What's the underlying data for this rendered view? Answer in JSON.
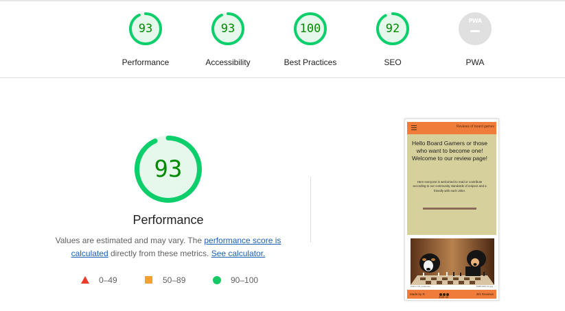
{
  "categories": [
    {
      "label": "Performance",
      "score": "93",
      "fraction": 0.93
    },
    {
      "label": "Accessibility",
      "score": "93",
      "fraction": 0.93
    },
    {
      "label": "Best Practices",
      "score": "100",
      "fraction": 1.0
    },
    {
      "label": "SEO",
      "score": "92",
      "fraction": 0.92
    },
    {
      "label": "PWA",
      "badge": "PWA"
    }
  ],
  "main": {
    "score": "93",
    "fraction": 0.93,
    "title": "Performance",
    "desc_prefix": "Values are estimated and may vary. The ",
    "link_score": "performance score is calculated",
    "desc_middle": " directly from these metrics. ",
    "link_calc": "See calculator."
  },
  "legend": [
    {
      "range": "0–49",
      "shape": "triangle",
      "color": "#eb3b2c"
    },
    {
      "range": "50–89",
      "shape": "square",
      "color": "#f3a230"
    },
    {
      "range": "90–100",
      "shape": "circle",
      "color": "#17c964"
    }
  ],
  "colors": {
    "pass": "#0cce6b",
    "pass_text": "#008a00",
    "pass_fill": "#e6f7ec",
    "phone_accent": "#f07c3c",
    "phone_hero": "#d6d09c"
  },
  "screenshot": {
    "top_title": "Reviews of board games",
    "heading": "Hello Board Gamers or those who want to become one! Welcome to our review page!",
    "paragraph": "Here everyone is welcomed to read or contribute according to our community standards of respect and a friendly with each other.",
    "caption_left": "Author: Pit_superuser",
    "caption_right": "1998-2023 CC.jpg",
    "footer_left": "Made by R",
    "footer_center": "Join us",
    "footer_right": "BG Reviews"
  }
}
